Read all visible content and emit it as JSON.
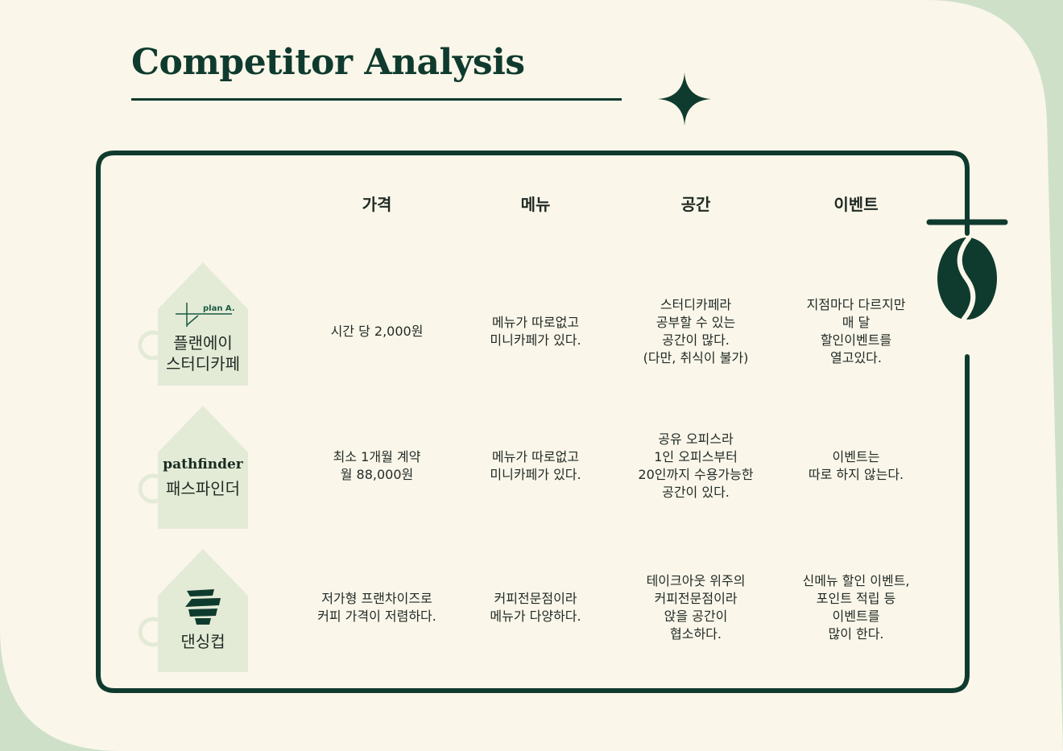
{
  "title": "Competitor Analysis",
  "columns": [
    "가격",
    "메뉴",
    "공간",
    "이벤트"
  ],
  "competitors": [
    {
      "name": "플랜에이\n스터디카페",
      "logo_text": "plan A.",
      "price": "시간 당 2,000원",
      "menu": "메뉴가 따로없고\n미니카페가 있다.",
      "space": "스터디카페라\n공부할 수 있는\n공간이 많다.\n(다만, 취식이 불가)",
      "event": "지점마다 다르지만\n매 달\n할인이벤트를\n열고있다."
    },
    {
      "name": "패스파인더",
      "logo_text": "pathfinder",
      "price": "최소 1개월 계약\n월 88,000원",
      "menu": "메뉴가 따로없고\n미니카페가 있다.",
      "space": "공유 오피스라\n1인 오피스부터\n20인까지 수용가능한\n공간이 있다.",
      "event": "이벤트는\n따로 하지 않는다."
    },
    {
      "name": "댄싱컵",
      "logo_text": "",
      "price": "저가형 프랜차이즈로\n커피 가격이 저렴하다.",
      "menu": "커피전문점이라\n메뉴가 다양하다.",
      "space": "테이크아웃 위주의\n커피전문점이라\n앉을 공간이\n협소하다.",
      "event": "신메뉴 할인 이벤트,\n포인트 적립 등\n이벤트를\n많이 한다."
    }
  ],
  "colors": {
    "background": "#cfe0c9",
    "paper": "#fbf6ea",
    "accent": "#0f3b2e",
    "tag": "#e3ebd6"
  },
  "icons": [
    "sparkle-icon",
    "coffee-bean-icon",
    "plan-a-logo-icon",
    "dancing-cup-logo-icon"
  ]
}
